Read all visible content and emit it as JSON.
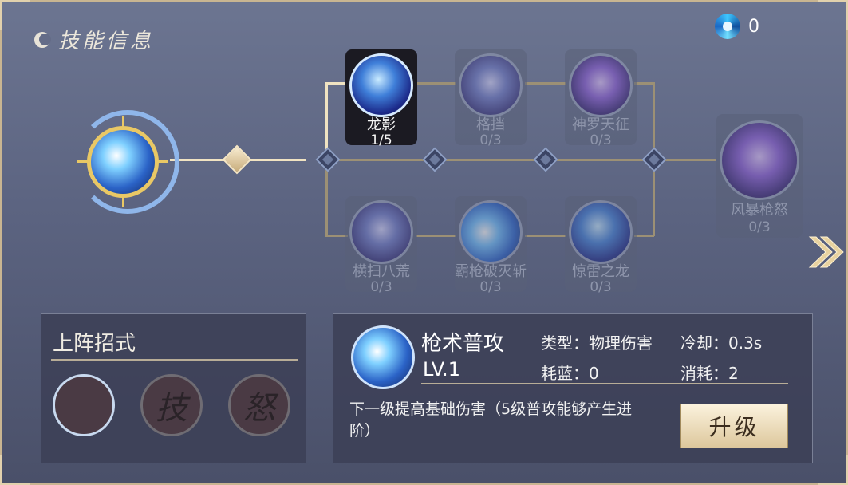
{
  "title": "技能信息",
  "currency": {
    "value": "0",
    "icon": "spiral-orb-icon"
  },
  "tree": {
    "branch_top": [
      {
        "name": "龙影",
        "level": "1/5",
        "state": "active"
      },
      {
        "name": "格挡",
        "level": "0/3",
        "state": "locked"
      },
      {
        "name": "神罗天征",
        "level": "0/3",
        "state": "locked"
      }
    ],
    "branch_bottom": [
      {
        "name": "横扫八荒",
        "level": "0/3",
        "state": "locked"
      },
      {
        "name": "霸枪破灭斩",
        "level": "0/3",
        "state": "locked"
      },
      {
        "name": "惊雷之龙",
        "level": "0/3",
        "state": "locked"
      }
    ],
    "final": {
      "name": "风暴枪怒",
      "level": "0/3",
      "state": "locked"
    }
  },
  "loadout": {
    "title": "上阵招式",
    "slots": [
      {
        "type": "skill",
        "label": ""
      },
      {
        "type": "empty",
        "label": "技"
      },
      {
        "type": "empty",
        "label": "怒"
      }
    ]
  },
  "detail": {
    "name": "枪术普攻",
    "level": "LV.1",
    "type_label": "类型：物理伤害",
    "cooldown_label": "冷却：0.3s",
    "mana_label": "耗蓝：0",
    "cost_label": "消耗：2",
    "description": "下一级提高基础伤害（5级普攻能够产生进阶）",
    "upgrade_label": "升级"
  },
  "colors": {
    "accent_gold": "#e9c865",
    "panel_bg": "#3c4056",
    "button_bg": "#f4e6c6"
  }
}
